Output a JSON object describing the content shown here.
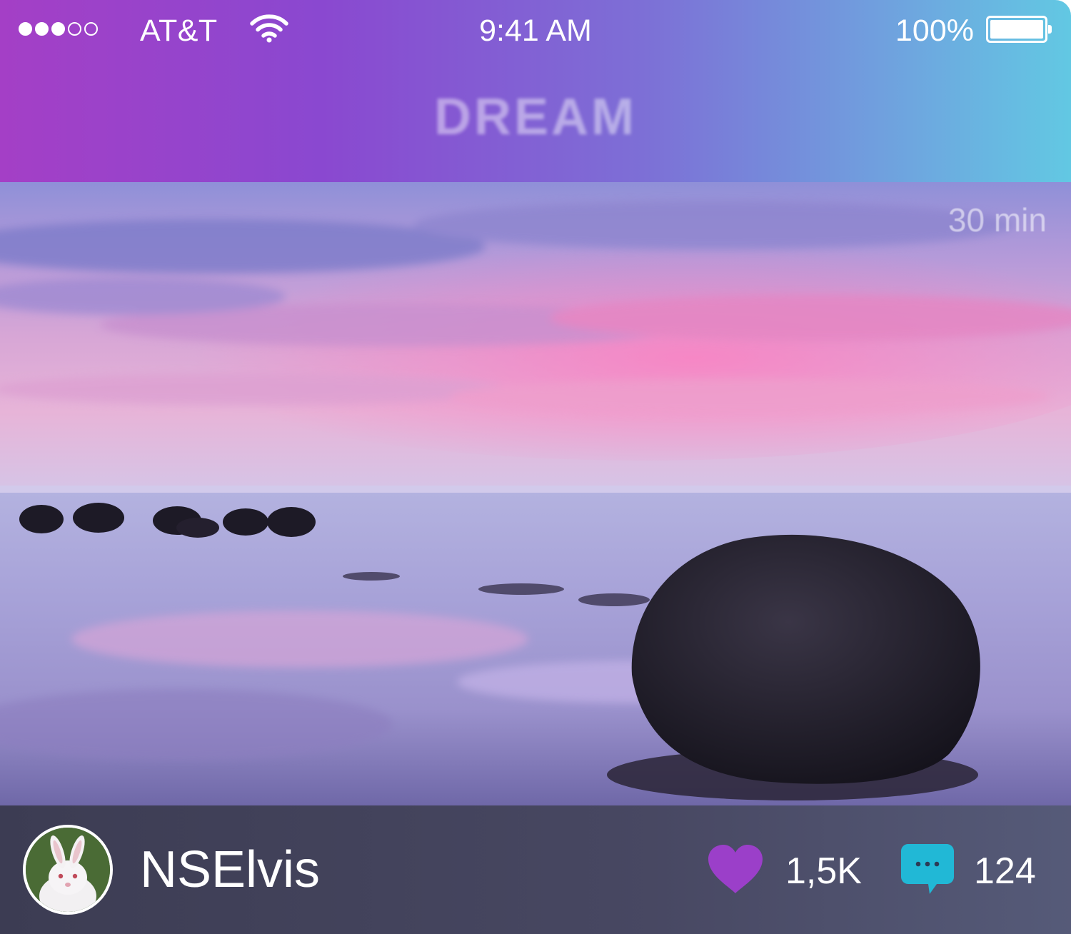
{
  "status_bar": {
    "signal_bars_filled": 3,
    "signal_bars_total": 5,
    "carrier": "AT&T",
    "time": "9:41 AM",
    "battery_percent": "100%",
    "battery_level": 1.0
  },
  "header": {
    "title": "DREAM",
    "gradient_colors": [
      "#a43fc6",
      "#8a48d0",
      "#7d6fd6",
      "#6ea6df",
      "#62c8e3"
    ]
  },
  "post": {
    "timestamp": "30 min",
    "author": {
      "username": "NSElvis",
      "avatar_icon": "rabbit-avatar"
    },
    "likes": {
      "icon": "heart-icon",
      "count": "1,5K",
      "color": "#9b3fc9"
    },
    "comments": {
      "icon": "comment-icon",
      "count": "124",
      "color": "#21b8d6"
    }
  }
}
